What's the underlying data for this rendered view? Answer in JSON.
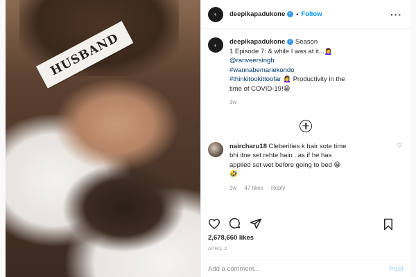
{
  "photo": {
    "tape_text": "HUSBAND"
  },
  "header": {
    "username": "deepikapadukone",
    "separator": "•",
    "follow_label": "Follow",
    "more_icon": "ellipsis-icon"
  },
  "caption": {
    "username": "deepikapadukone",
    "text_part1": "Season 1:Episode 7: & while I was at it...🙍‍♀️",
    "mention": "@ranveersingh",
    "hashtag1": "#wannabemariekondo",
    "hashtag2": "#thinkitookittoofar",
    "text_part2": "🙍‍♀️ Productivity in the time of COVID-19!😁",
    "time": "3w"
  },
  "load_more_icon": "plus-circle-icon",
  "comment": {
    "username": "naircharu18",
    "text": "Cleberities k hair sote time bhi itne set rehte hain ..as if he has applied set wet before going to bed 😁🤣",
    "time": "3w",
    "likes": "47 likes",
    "reply": "Reply"
  },
  "actions": {
    "icons": [
      "heart-icon",
      "comment-icon",
      "share-icon",
      "bookmark-icon"
    ]
  },
  "likes": "2,678,660 likes",
  "date": "APRIL 2",
  "add_comment": {
    "placeholder": "Add a comment...",
    "post_label": "Post"
  },
  "colors": {
    "accent": "#0095f6",
    "verified": "#3897f0",
    "text": "#262626",
    "muted": "#8e8e8e"
  }
}
